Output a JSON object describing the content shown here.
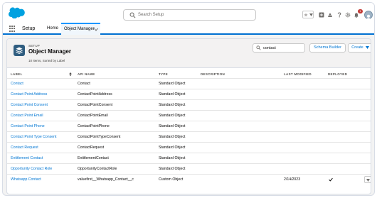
{
  "header": {
    "logo": "salesforce-cloud-logo",
    "search_placeholder": "Search Setup",
    "notification_count": "1"
  },
  "nav": {
    "app_name": "Setup",
    "home_label": "Home",
    "active_tab_label": "Object Manager"
  },
  "page": {
    "breadcrumb": "SETUP",
    "title": "Object Manager",
    "meta": "10 Items, Sorted by Label",
    "quick_find_value": "contact",
    "schema_builder_label": "Schema Builder",
    "create_label": "Create"
  },
  "table": {
    "columns": [
      "LABEL",
      "API NAME",
      "TYPE",
      "DESCRIPTION",
      "LAST MODIFIED",
      "DEPLOYED"
    ],
    "rows": [
      {
        "label": "Contact",
        "api_name": "Contact",
        "type": "Standard Object",
        "description": "",
        "last_modified": "",
        "deployed": false
      },
      {
        "label": "Contact Point Address",
        "api_name": "ContactPointAddress",
        "type": "Standard Object",
        "description": "",
        "last_modified": "",
        "deployed": false
      },
      {
        "label": "Contact Point Consent",
        "api_name": "ContactPointConsent",
        "type": "Standard Object",
        "description": "",
        "last_modified": "",
        "deployed": false
      },
      {
        "label": "Contact Point Email",
        "api_name": "ContactPointEmail",
        "type": "Standard Object",
        "description": "",
        "last_modified": "",
        "deployed": false
      },
      {
        "label": "Contact Point Phone",
        "api_name": "ContactPointPhone",
        "type": "Standard Object",
        "description": "",
        "last_modified": "",
        "deployed": false
      },
      {
        "label": "Contact Point Type Consent",
        "api_name": "ContactPointTypeConsent",
        "type": "Standard Object",
        "description": "",
        "last_modified": "",
        "deployed": false
      },
      {
        "label": "Contact Request",
        "api_name": "ContactRequest",
        "type": "Standard Object",
        "description": "",
        "last_modified": "",
        "deployed": false
      },
      {
        "label": "Entitlement Contact",
        "api_name": "EntitlementContact",
        "type": "Standard Object",
        "description": "",
        "last_modified": "",
        "deployed": false
      },
      {
        "label": "Opportunity Contact Role",
        "api_name": "OpportunityContactRole",
        "type": "Standard Object",
        "description": "",
        "last_modified": "",
        "deployed": false
      },
      {
        "label": "Whatsapp Contact",
        "api_name": "valuefirst__Whatsapp_Contact__c",
        "type": "Custom Object",
        "description": "",
        "last_modified": "2/14/2023",
        "deployed": true
      }
    ]
  },
  "colors": {
    "brand_blue": "#0176d3",
    "nav_underline": "#0070d2",
    "logo_blue": "#00a1e0",
    "object_icon": "#2f5d80"
  }
}
